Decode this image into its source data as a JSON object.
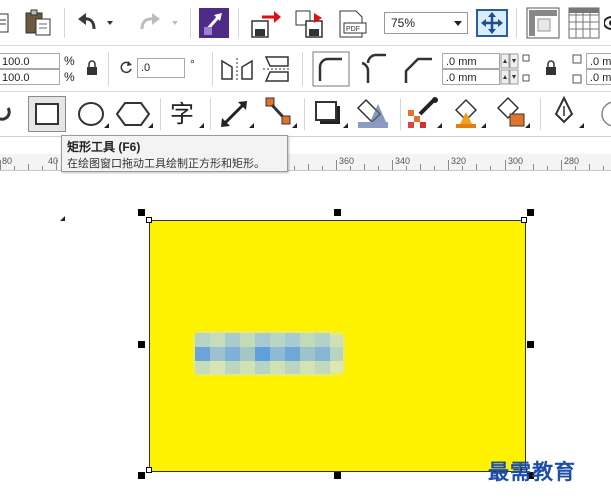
{
  "toolbar": {
    "zoom_value": "75%"
  },
  "property_bar": {
    "width_percent": "100.0",
    "height_percent": "100.0",
    "percent_symbol": "%",
    "rotation_value": ".0",
    "degree_symbol": "°",
    "corner_x": ".0 mm",
    "corner_y": ".0 mm",
    "corner_x2": ".0 m",
    "corner_y2": ".0 m"
  },
  "tooltip": {
    "title": "矩形工具 (F6)",
    "description": "在绘图窗口拖动工具绘制正方形和矩形。"
  },
  "ruler": {
    "labels": [
      "80",
      "40",
      "360",
      "340",
      "320",
      "300",
      "280"
    ]
  },
  "watermark": "最需教育",
  "colors": {
    "rectangle_fill": "#fff200",
    "watermark": "#1f4ea8"
  }
}
